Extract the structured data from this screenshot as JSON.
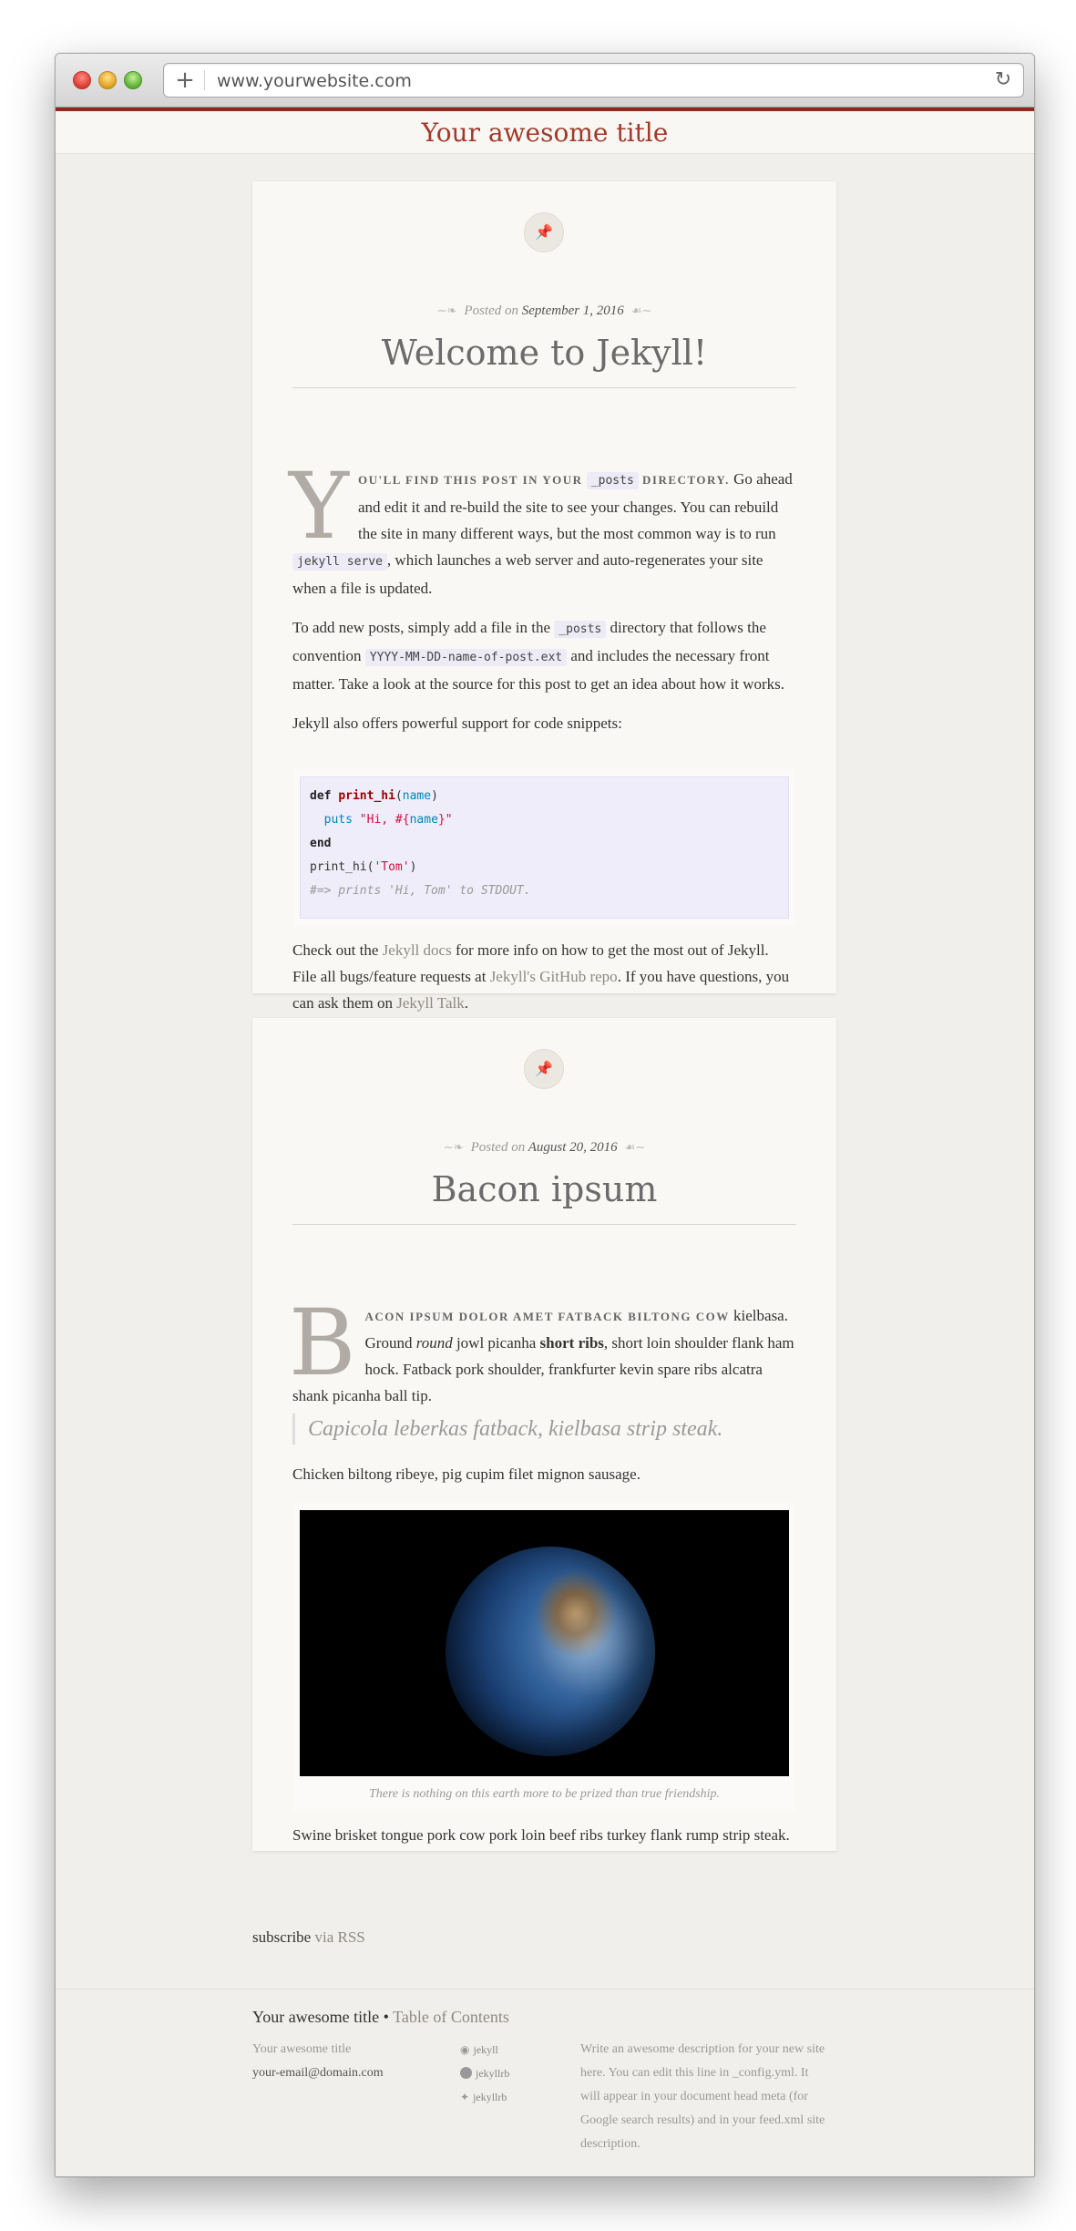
{
  "browser": {
    "url": "www.yourwebsite.com"
  },
  "site": {
    "title": "Your awesome title"
  },
  "posts": [
    {
      "posted_on": "Posted on",
      "date": "September 1, 2016",
      "title": "Welcome to Jekyll!",
      "dropcap": "Y",
      "lead_caps_1": "ou'll find this post in your",
      "lead_code": "_posts",
      "lead_caps_2": "directory.",
      "p1_rest": "Go ahead and edit it and re-build the site to see your changes. You can rebuild the site in many different ways, but the most common way is to run",
      "p1_code": "jekyll serve",
      "p1_end": ", which launches a web server and auto-regenerates your site when a file is updated.",
      "p2_a": "To add new posts, simply add a file in the",
      "p2_code1": "_posts",
      "p2_b": "directory that follows the convention",
      "p2_code2": "YYYY-MM-DD-name-of-post.ext",
      "p2_c": "and includes the necessary front matter. Take a look at the source for this post to get an idea about how it works.",
      "p3": "Jekyll also offers powerful support for code snippets:",
      "code": {
        "l1_kw": "def",
        "l1_fn": "print_hi",
        "l1_open": "(",
        "l1_var": "name",
        "l1_close": ")",
        "l2_indent": "  ",
        "l2_var": "puts",
        "l2_str1": "\"Hi, #{",
        "l2_var2": "name",
        "l2_str2": "}\"",
        "l3_kw": "end",
        "l4_a": "print_hi(",
        "l4_str": "'Tom'",
        "l4_b": ")",
        "l5_cm": "#=> prints 'Hi, Tom' to STDOUT."
      },
      "p4_a": "Check out the",
      "p4_link1": "Jekyll docs",
      "p4_b": "for more info on how to get the most out of Jekyll. File all bugs/feature requests at",
      "p4_link2": "Jekyll's GitHub repo",
      "p4_c": ". If you have questions, you can ask them on",
      "p4_link3": "Jekyll Talk",
      "p4_d": "."
    },
    {
      "posted_on": "Posted on",
      "date": "August 20, 2016",
      "title": "Bacon ipsum",
      "dropcap": "B",
      "lead_caps": "acon ipsum dolor amet fatback biltong cow",
      "p1_a": "kielbasa. Ground",
      "p1_em": "round",
      "p1_b": "jowl picanha",
      "p1_strong": "short ribs",
      "p1_c": ", short loin shoulder flank ham hock. Fatback pork shoulder, frankfurter kevin spare ribs alcatra shank picanha ball tip.",
      "quote": "Capicola leberkas fatback, kielbasa strip steak.",
      "p2": "Chicken biltong ribeye, pig cupim filet mignon sausage.",
      "caption": "There is nothing on this earth more to be prized than true friendship.",
      "p3": "Swine brisket tongue pork cow pork loin beef ribs turkey flank rump strip steak."
    }
  ],
  "subscribe": {
    "label": "subscribe",
    "link": "via RSS"
  },
  "footer": {
    "title": "Your awesome title",
    "bullet": "•",
    "toc_link": "Table of Contents",
    "name": "Your awesome title",
    "email": "your-email@domain.com",
    "social": [
      {
        "icon": "github-icon",
        "label": "jekyll"
      },
      {
        "icon": "dribbble-icon",
        "label": "jekyllrb"
      },
      {
        "icon": "twitter-icon",
        "label": "jekyllrb"
      }
    ],
    "description": "Write an awesome description for your new site here. You can edit this line in _config.yml. It will appear in your document head meta (for Google search results) and in your feed.xml site description."
  }
}
